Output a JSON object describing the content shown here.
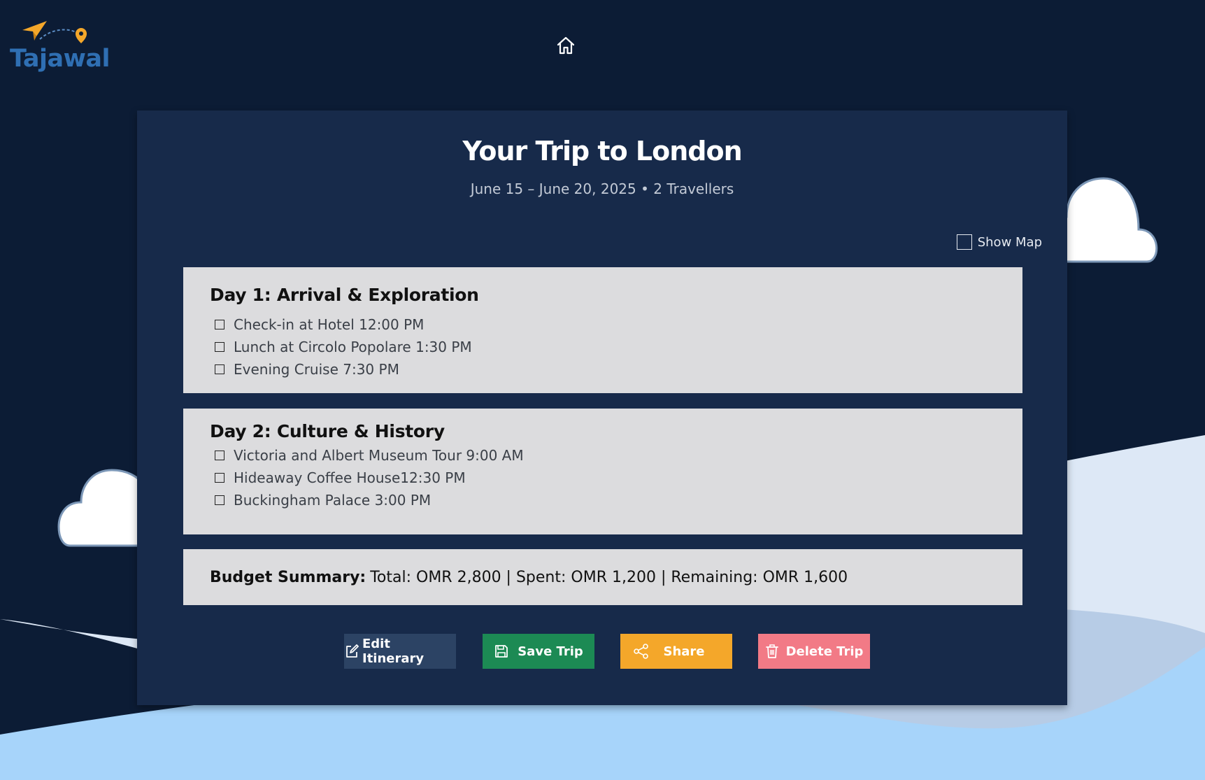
{
  "brand": {
    "name": "Tajawal",
    "color": "#2f6fb3",
    "accent": "#f4a72a"
  },
  "nav": {
    "home_icon": "home-icon"
  },
  "trip": {
    "title": "Your Trip to London",
    "subtitle": "June 15 – June 20, 2025 • 2 Travellers"
  },
  "show_map": {
    "label": "Show Map",
    "checked": false
  },
  "days": [
    {
      "title": "Day 1: Arrival & Exploration",
      "tasks": [
        {
          "text": "Check-in at Hotel 12:00 PM",
          "checked": false
        },
        {
          "text": "Lunch at Circolo Popolare 1:30 PM",
          "checked": false
        },
        {
          "text": "Evening Cruise 7:30 PM",
          "checked": false
        }
      ]
    },
    {
      "title": "Day 2: Culture & History",
      "tasks": [
        {
          "text": "Victoria and Albert Museum Tour 9:00 AM",
          "checked": false
        },
        {
          "text": "Hideaway Coffee House12:30 PM",
          "checked": false
        },
        {
          "text": "Buckingham Palace 3:00 PM",
          "checked": false
        }
      ]
    }
  ],
  "budget": {
    "label": "Budget Summary:",
    "text": "Total: OMR 2,800 | Spent: OMR 1,200 | Remaining: OMR 1,600"
  },
  "actions": {
    "edit_label": "Edit Itinerary",
    "save_label": "Save Trip",
    "share_label": "Share",
    "delete_label": "Delete Trip",
    "edit_icon": "edit-icon",
    "save_icon": "save-icon",
    "share_icon": "share-icon",
    "delete_icon": "trash-icon",
    "edit_color": "#2c4364",
    "save_color": "#1c8a54",
    "share_color": "#f4a72a",
    "delete_color": "#f27a86"
  },
  "colors": {
    "background": "#0c1c35",
    "card": "#172a4a",
    "panel": "#dcdcde",
    "wave_light": "#dde8f6",
    "wave_mid": "#b7cce6",
    "wave_blue": "#a7d4fa"
  }
}
